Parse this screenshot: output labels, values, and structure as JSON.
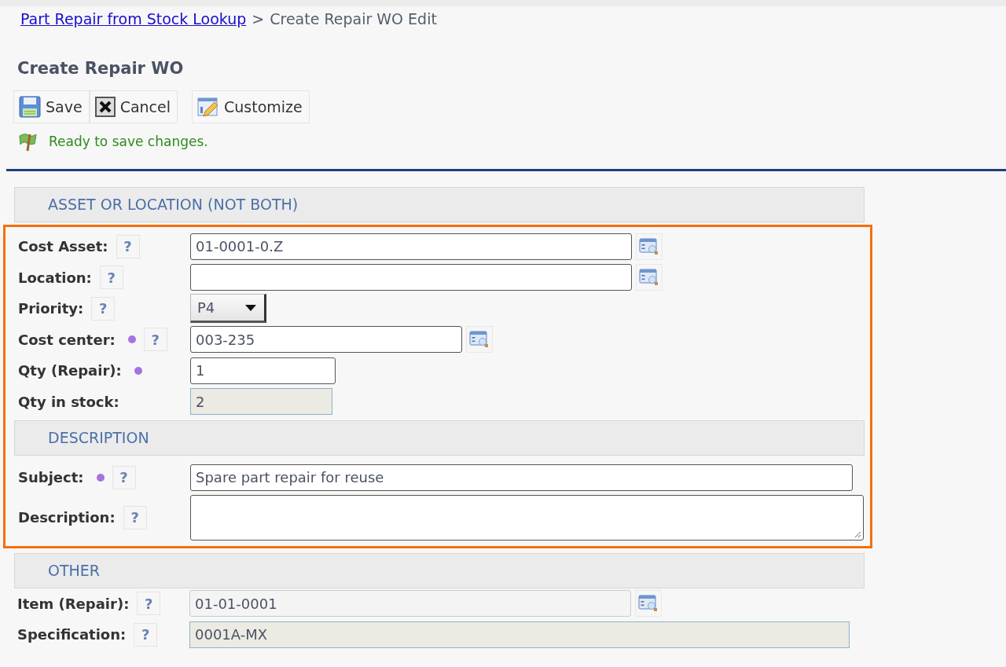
{
  "breadcrumb": {
    "link": "Part Repair from Stock Lookup",
    "separator": ">",
    "current": "Create Repair WO Edit"
  },
  "title": "Create Repair WO",
  "toolbar": [
    {
      "kind": "save",
      "label": "Save"
    },
    {
      "kind": "cancel",
      "label": "Cancel"
    },
    {
      "kind": "customize",
      "label": "Customize"
    }
  ],
  "status": "Ready to save changes.",
  "form": [
    {
      "kind": "section",
      "title": "ASSET OR LOCATION (NOT BOTH)"
    },
    {
      "kind": "highlight",
      "items": [
        {
          "kind": "lookup",
          "label": "Cost Asset:",
          "required": false,
          "help": "?",
          "value": "01-0001-0.Z"
        },
        {
          "kind": "lookup",
          "label": "Location:",
          "required": false,
          "help": "?",
          "value": ""
        },
        {
          "kind": "select",
          "label": "Priority:",
          "required": false,
          "help": "?",
          "value": "P4"
        },
        {
          "kind": "lookup",
          "label": "Cost center:",
          "required": true,
          "help": "?",
          "value": "003-235"
        },
        {
          "kind": "text",
          "label": "Qty (Repair):",
          "required": true,
          "value": "1"
        },
        {
          "kind": "readonly",
          "label": "Qty in stock:",
          "required": false,
          "value": "2"
        },
        {
          "kind": "section",
          "title": "DESCRIPTION"
        },
        {
          "kind": "text",
          "label": "Subject:",
          "required": true,
          "help": "?",
          "value": "Spare part repair for reuse"
        },
        {
          "kind": "textarea",
          "label": "Description:",
          "required": false,
          "help": "?",
          "value": ""
        }
      ]
    },
    {
      "kind": "section",
      "title": "OTHER"
    },
    {
      "kind": "disabled-lookup",
      "label": "Item (Repair):",
      "required": false,
      "help": "?",
      "value": "01-01-0001"
    },
    {
      "kind": "readonly",
      "label": "Specification:",
      "required": false,
      "help": "?",
      "value": "0001A-MX"
    }
  ]
}
